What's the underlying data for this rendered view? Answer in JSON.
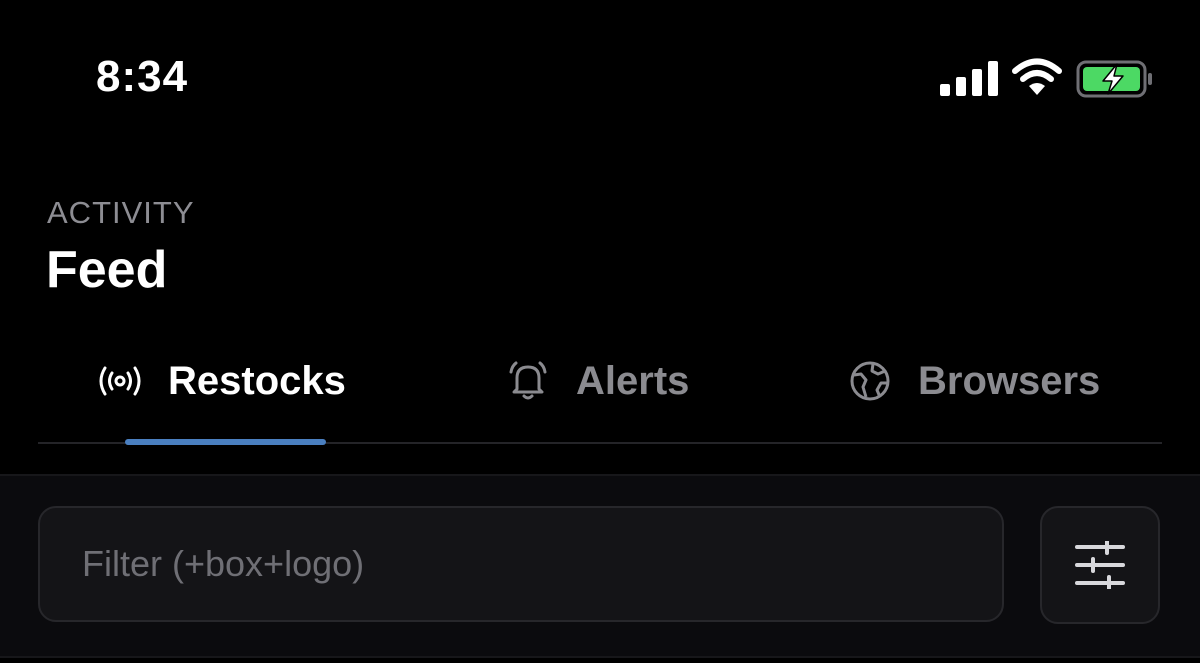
{
  "status_bar": {
    "time": "8:34",
    "icons": [
      "cellular-signal-icon",
      "wifi-icon",
      "battery-charging-icon"
    ],
    "battery_color": "#4cd964"
  },
  "header": {
    "eyebrow": "ACTIVITY",
    "title": "Feed"
  },
  "tabs": [
    {
      "label": "Restocks",
      "icon": "broadcast-icon",
      "active": true
    },
    {
      "label": "Alerts",
      "icon": "bell-icon",
      "active": false
    },
    {
      "label": "Browsers",
      "icon": "globe-icon",
      "active": false
    }
  ],
  "filter": {
    "placeholder": "Filter (+box+logo)",
    "value": "",
    "settings_icon": "sliders-icon"
  },
  "colors": {
    "background": "#000000",
    "accent": "#4a7fc0",
    "muted_text": "#8b8b90"
  }
}
